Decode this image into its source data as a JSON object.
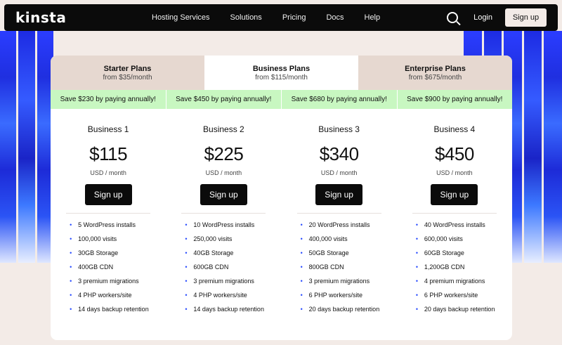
{
  "nav": {
    "logo": "kinsta",
    "menu": [
      "Hosting Services",
      "Solutions",
      "Pricing",
      "Docs",
      "Help"
    ],
    "login_label": "Login",
    "signup_label": "Sign up"
  },
  "plan_tabs": [
    {
      "title": "Starter Plans",
      "subtitle": "from $35/month"
    },
    {
      "title": "Business Plans",
      "subtitle": "from $115/month"
    },
    {
      "title": "Enterprise Plans",
      "subtitle": "from $675/month"
    }
  ],
  "savings": [
    "Save $230 by paying annually!",
    "Save $450 by paying annually!",
    "Save $680 by paying annually!",
    "Save $900 by paying annually!"
  ],
  "plans": [
    {
      "name": "Business 1",
      "price": "$115",
      "per": "USD  / month",
      "cta": "Sign up",
      "features": [
        "5 WordPress installs",
        "100,000 visits",
        "30GB Storage",
        "400GB CDN",
        "3 premium migrations",
        "4 PHP workers/site",
        "14 days backup retention"
      ]
    },
    {
      "name": "Business 2",
      "price": "$225",
      "per": "USD  / month",
      "cta": "Sign up",
      "features": [
        "10 WordPress installs",
        "250,000 visits",
        "40GB Storage",
        "600GB CDN",
        "3 premium migrations",
        "4 PHP workers/site",
        "14 days backup retention"
      ]
    },
    {
      "name": "Business 3",
      "price": "$340",
      "per": "USD  / month",
      "cta": "Sign up",
      "features": [
        "20 WordPress installs",
        "400,000 visits",
        "50GB Storage",
        "800GB CDN",
        "3 premium migrations",
        "6 PHP workers/site",
        "20 days backup retention"
      ]
    },
    {
      "name": "Business 4",
      "price": "$450",
      "per": "USD  / month",
      "cta": "Sign up",
      "features": [
        "40 WordPress installs",
        "600,000 visits",
        "60GB Storage",
        "1,200GB CDN",
        "4 premium migrations",
        "6 PHP workers/site",
        "20 days backup retention"
      ]
    }
  ],
  "colors": {
    "accent_blue": "#2b3dff",
    "nav_bg": "#0b0b0b",
    "tab_inactive": "#e6d8d0",
    "save_bg": "#c8f7c1",
    "page_bg": "#f3ebe7"
  }
}
